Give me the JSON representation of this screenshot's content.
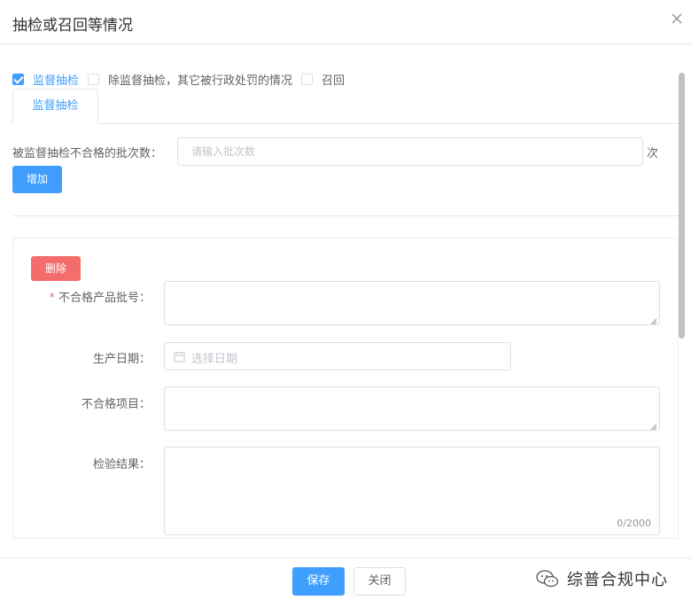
{
  "dialog": {
    "title": "抽检或召回等情况"
  },
  "filters": {
    "options": [
      {
        "label": "监督抽检",
        "checked": true
      },
      {
        "label": "除监督抽检，其它被行政处罚的情况",
        "checked": false
      },
      {
        "label": "召回",
        "checked": false
      }
    ]
  },
  "tabs": [
    {
      "label": "监督抽检",
      "active": true
    }
  ],
  "batch": {
    "label": "被监督抽检不合格的批次数：",
    "placeholder": "请输入批次数",
    "value": "",
    "unit": "次"
  },
  "buttons": {
    "add": "增加",
    "delete": "删除",
    "save": "保存",
    "close": "关闭"
  },
  "record_form": {
    "batch_no": {
      "label": "不合格产品批号：",
      "required_mark": "*",
      "value": ""
    },
    "production_date": {
      "label": "生产日期：",
      "placeholder": "选择日期"
    },
    "failed_items": {
      "label": "不合格项目：",
      "value": ""
    },
    "inspection_result": {
      "label": "检验结果：",
      "value": "",
      "counter": "0/2000"
    }
  },
  "watermark": {
    "text": "综普合规中心"
  },
  "colors": {
    "primary": "#409eff",
    "danger": "#f56c6c",
    "border": "#dcdfe6",
    "text": "#606266",
    "placeholder": "#c0c4cc"
  }
}
